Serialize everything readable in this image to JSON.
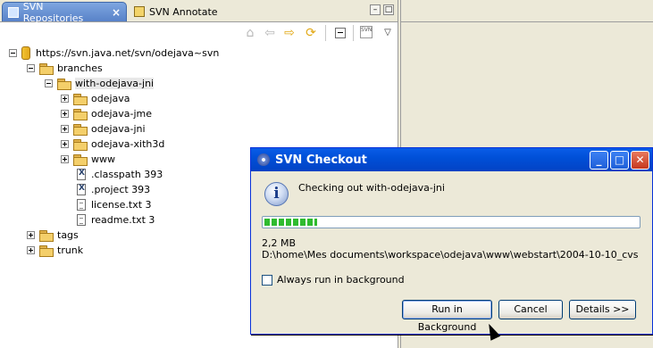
{
  "tabs": {
    "active": "SVN Repositories",
    "inactive": "SVN Annotate"
  },
  "icons": {
    "tab_close": "×",
    "window_minimize": "–",
    "window_maximize": "□",
    "toolbar_home": "⌂",
    "toolbar_back": "⇦",
    "toolbar_forward": "⇨",
    "toolbar_refresh": "⟳",
    "toolbar_svn": "SVN",
    "view_menu": "▽",
    "info": "i",
    "dialog_minimize": "_",
    "dialog_maximize": "□",
    "dialog_close": "✕"
  },
  "tree": {
    "root": "https://svn.java.net/svn/odejava~svn",
    "branches": "branches",
    "with_odejava_jni": "with-odejava-jni",
    "odejava": "odejava",
    "odejava_jme": "odejava-jme",
    "odejava_jni": "odejava-jni",
    "odejava_xith3d": "odejava-xith3d",
    "www": "www",
    "classpath": ".classpath 393",
    "project": ".project 393",
    "license": "license.txt 3",
    "readme": "readme.txt 3",
    "tags": "tags",
    "trunk": "trunk"
  },
  "dialog": {
    "title": "SVN Checkout",
    "message": "Checking out with-odejava-jni",
    "progress_fraction": 0.14,
    "size": "2,2 MB",
    "path": "D:\\home\\Mes documents\\workspace\\odejava\\www\\webstart\\2004-10-10_cvs",
    "checkbox_label": "Always run in background",
    "buttons": {
      "run_background": "Run in Background",
      "cancel": "Cancel",
      "details": "Details >>"
    }
  }
}
